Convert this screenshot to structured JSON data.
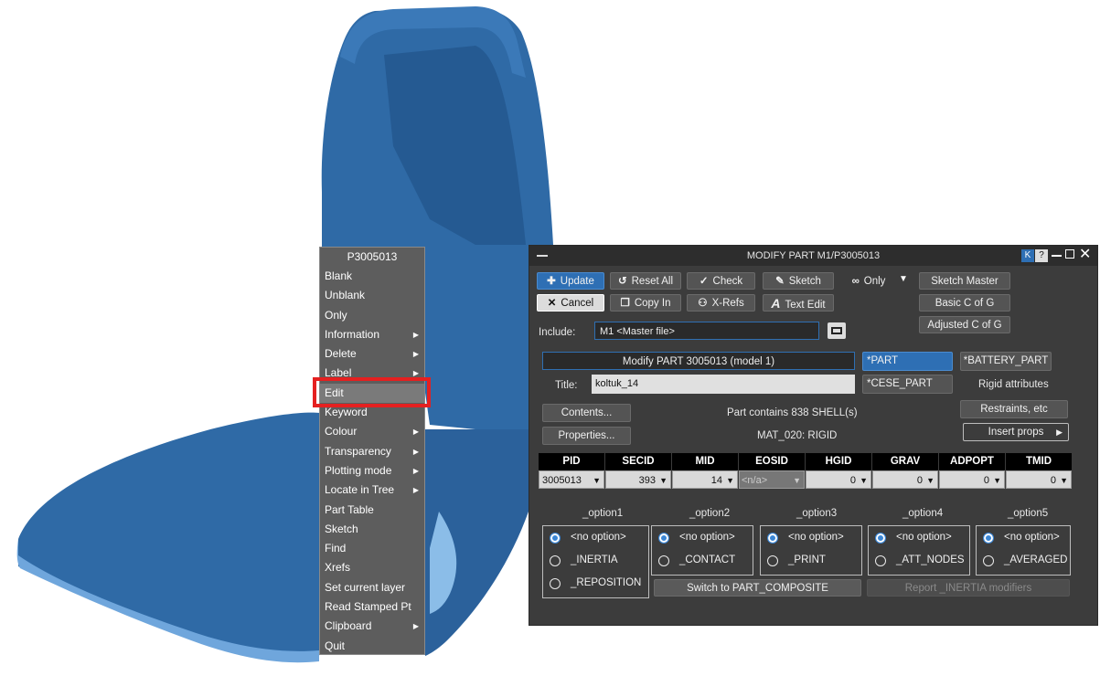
{
  "context_menu": {
    "title": "P3005013",
    "items": [
      {
        "label": "Blank",
        "sub": false
      },
      {
        "label": "Unblank",
        "sub": false
      },
      {
        "label": "Only",
        "sub": false
      },
      {
        "label": "Information",
        "sub": true
      },
      {
        "label": "Delete",
        "sub": true
      },
      {
        "label": "Label",
        "sub": true
      },
      {
        "label": "Edit",
        "sub": false
      },
      {
        "label": "Keyword",
        "sub": false
      },
      {
        "label": "Colour",
        "sub": true
      },
      {
        "label": "Transparency",
        "sub": true
      },
      {
        "label": "Plotting mode",
        "sub": true
      },
      {
        "label": "Locate in Tree",
        "sub": true
      },
      {
        "label": "Part Table",
        "sub": false
      },
      {
        "label": "Sketch",
        "sub": false
      },
      {
        "label": "Find",
        "sub": false
      },
      {
        "label": "Xrefs",
        "sub": false
      },
      {
        "label": "Set current layer",
        "sub": false
      },
      {
        "label": "Read Stamped Pt",
        "sub": false
      },
      {
        "label": "Clipboard",
        "sub": true
      },
      {
        "label": "Quit",
        "sub": false
      }
    ]
  },
  "dialog": {
    "title": "MODIFY PART M1/P3005013",
    "title_btn_k": "K",
    "title_btn_help": "?",
    "toolbar": {
      "update": "Update",
      "reset_all": "Reset All",
      "check": "Check",
      "sketch": "Sketch",
      "only": "Only",
      "sketch_master": "Sketch Master",
      "cancel": "Cancel",
      "copy_in": "Copy In",
      "xrefs": "X-Refs",
      "text_edit": "Text Edit",
      "basic_cog": "Basic C of G",
      "adjusted_cog": "Adjusted C of G"
    },
    "include_label": "Include:",
    "include_value": "M1 <Master file>",
    "modify_banner": "Modify PART 3005013 (model 1)",
    "btn_part": "*PART",
    "btn_battery": "*BATTERY_PART",
    "btn_cese": "*CESE_PART",
    "title_label": "Title:",
    "title_value": "koltuk_14",
    "rigid_attributes": "Rigid attributes",
    "contents": "Contents...",
    "part_contains": "Part contains 838 SHELL(s)",
    "restraints": "Restraints, etc",
    "properties": "Properties...",
    "material": "MAT_020: RIGID",
    "insert_props": "Insert props",
    "table_headers": [
      "PID",
      "SECID",
      "MID",
      "EOSID",
      "HGID",
      "GRAV",
      "ADPOPT",
      "TMID"
    ],
    "table_values": [
      "3005013",
      "393",
      "14",
      "<n/a>",
      "0",
      "0",
      "0",
      "0"
    ],
    "options": [
      {
        "header": "_option1",
        "items": [
          "<no option>",
          "_INERTIA",
          "_REPOSITION"
        ]
      },
      {
        "header": "_option2",
        "items": [
          "<no option>",
          "_CONTACT"
        ]
      },
      {
        "header": "_option3",
        "items": [
          "<no option>",
          "_PRINT"
        ]
      },
      {
        "header": "_option4",
        "items": [
          "<no option>",
          "_ATT_NODES"
        ]
      },
      {
        "header": "_option5",
        "items": [
          "<no option>",
          "_AVERAGED"
        ]
      }
    ],
    "switch_composite": "Switch to PART_COMPOSITE",
    "report_inertia": "Report _INERTIA modifiers"
  },
  "colors": {
    "accent": "#2e6fb4",
    "highlight": "#e52020",
    "seat": "#2f6aa6"
  }
}
